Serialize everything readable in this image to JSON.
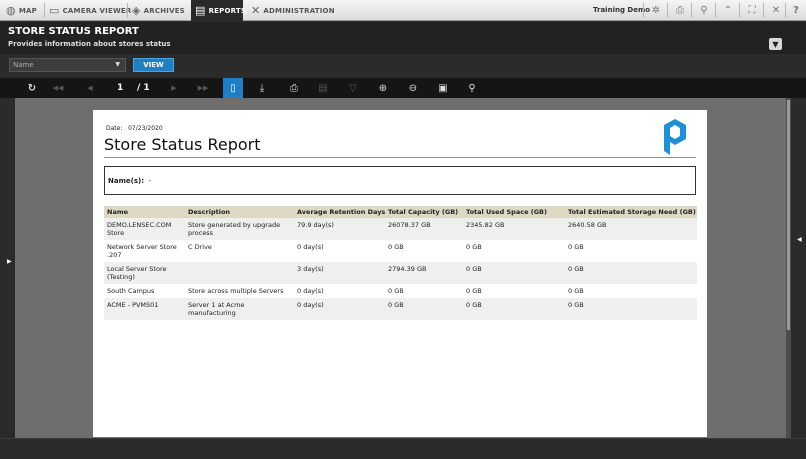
{
  "topnav": {
    "tabs": [
      {
        "label": "MAP",
        "icon": "globe-icon"
      },
      {
        "label": "CAMERA VIEWER",
        "icon": "monitor-icon"
      },
      {
        "label": "ARCHIVES",
        "icon": "archive-icon"
      },
      {
        "label": "REPORTS",
        "icon": "report-icon",
        "active": true
      },
      {
        "label": "ADMINISTRATION",
        "icon": "tools-icon"
      }
    ],
    "user": "Training Demo",
    "tools": [
      {
        "name": "settings-icon",
        "glyph": "✲"
      },
      {
        "name": "print-icon",
        "glyph": "⎙"
      },
      {
        "name": "search-icon",
        "glyph": "⚲"
      },
      {
        "name": "collapse-icon",
        "glyph": "⌃"
      },
      {
        "name": "fullscreen-icon",
        "glyph": "⛶"
      },
      {
        "name": "close-icon",
        "glyph": "✕"
      },
      {
        "name": "help-icon",
        "glyph": "?"
      }
    ]
  },
  "header": {
    "title": "STORE STATUS REPORT",
    "subtitle": "Provides information about stores status"
  },
  "controls": {
    "select_value": "Name",
    "view_label": "VIEW"
  },
  "viewer": {
    "page_current": "1",
    "page_total": "/ 1"
  },
  "report": {
    "date_label": "Date:",
    "date_value": "07/23/2020",
    "title": "Store Status Report",
    "names_label": "Name(s):",
    "names_value": "-",
    "columns": [
      "Name",
      "Description",
      "Average Retention Days",
      "Total Capacity (GB)",
      "Total Used Space (GB)",
      "Total Estimated Storage Need (GB)"
    ],
    "rows": [
      [
        "DEMO.LENSEC.COM Store",
        "Store generated by upgrade process",
        "79.9  day(s)",
        "26078.37 GB",
        "2345.82 GB",
        "2640.58 GB"
      ],
      [
        "Network Server Store .207",
        "C Drive",
        "0  day(s)",
        "0 GB",
        "0 GB",
        "0 GB"
      ],
      [
        "Local Server Store (Testing)",
        "",
        "3  day(s)",
        "2794.39 GB",
        "0 GB",
        "0 GB"
      ],
      [
        "South Campus",
        "Store across multiple Servers",
        "0  day(s)",
        "0 GB",
        "0 GB",
        "0 GB"
      ],
      [
        "ACME - PVMS01",
        "Server 1 at Acme manufacturing",
        "0  day(s)",
        "0 GB",
        "0 GB",
        "0 GB"
      ]
    ]
  },
  "colors": {
    "accent": "#1e7fc7",
    "header_bg": "#222222",
    "table_header": "#ddd9c4",
    "logo": "#1e90d8"
  }
}
